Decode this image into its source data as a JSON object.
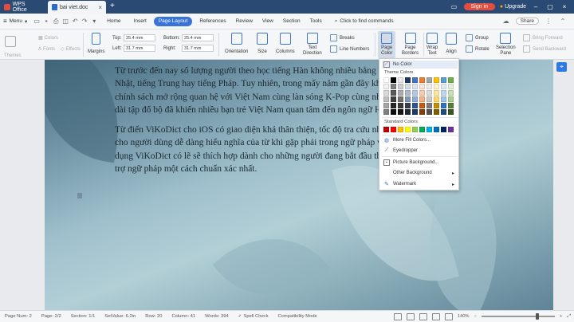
{
  "titlebar": {
    "app_tab": "WPS Office",
    "doc_tab": "bai viet.doc",
    "signin": "Sign in",
    "upgrade": "Upgrade"
  },
  "menubar": {
    "menu": "Menu",
    "tabs": [
      "Home",
      "Insert",
      "Page Layout",
      "References",
      "Review",
      "View",
      "Section",
      "Tools"
    ],
    "active_tab": "Page Layout",
    "find": "Click to find commands",
    "share": "Share"
  },
  "ribbon": {
    "themes": "Themes",
    "colors": "Colors",
    "fonts": "Fonts",
    "effects": "Effects",
    "margins": "Margins",
    "top_label": "Top:",
    "top_value": "25.4 mm",
    "bottom_label": "Bottom:",
    "bottom_value": "25.4 mm",
    "left_label": "Left:",
    "left_value": "31.7 mm",
    "right_label": "Right:",
    "right_value": "31.7 mm",
    "orientation": "Orientation",
    "size": "Size",
    "columns": "Columns",
    "text_direction_1": "Text",
    "text_direction_2": "Direction",
    "breaks": "Breaks",
    "line_numbers": "Line Numbers",
    "page_color_1": "Page",
    "page_color_2": "Color",
    "page_borders_1": "Page",
    "page_borders_2": "Borders",
    "wrap_text_1": "Wrap",
    "wrap_text_2": "Text",
    "align": "Align",
    "group": "Group",
    "rotate": "Rotate",
    "selection_pane_1": "Selection",
    "selection_pane_2": "Pane",
    "bring_forward": "Bring Forward",
    "send_backward": "Send Backward"
  },
  "document": {
    "paragraphs": [
      "Từ trước đến nay số lượng người theo học tiếng Hàn không nhiều bằng tiếng Anh, tiếng Nhật, tiếng Trung hay tiếng Pháp. Tuy nhiên, trong mấy năm gần đây khi Hàn Quốc có các chính sách mở rộng quan hệ với Việt Nam cùng làn sóng K-Pop cùng những bộ phim drama dài tập đổ bộ đã khiến nhiều bạn trẻ Việt Nam quan tâm đến ngôn ngữ Hàn Quốc.",
      "Từ điển ViKoDict cho iOS có giao diện khá thân thiện, tốc độ tra cứu nhanh chóng đã giúp cho người dùng dễ dàng hiểu nghĩa của từ khi gặp phải trong ngữ pháp và giao tiếp. Ứng dụng ViKoDict có lẽ sẽ thích hợp dành cho những người đang bắt đầu theo học tiếng Hàn, hỗ trợ ngữ pháp một cách chuẩn xác nhất."
    ]
  },
  "dropdown": {
    "no_color": "No Color",
    "theme_colors": "Theme Colors",
    "standard_colors": "Standard Colors",
    "more_fill": "More Fill Colors...",
    "eyedropper": "Eyedropper",
    "picture_background": "Picture Background...",
    "other_background": "Other Background",
    "watermark": "Watermark",
    "theme_palette": [
      [
        "#ffffff",
        "#000000",
        "#e8e8e8",
        "#1f3864",
        "#4472c4",
        "#ed7d31",
        "#a5a5a5",
        "#ffc000",
        "#5b9bd5",
        "#70ad47"
      ],
      [
        "#f2f2f2",
        "#7f7f7f",
        "#d0cece",
        "#d6dce4",
        "#dae3f3",
        "#fbe5d6",
        "#ededed",
        "#fff2cc",
        "#deebf7",
        "#e2f0d9"
      ],
      [
        "#d9d9d9",
        "#595959",
        "#aeabab",
        "#adb9ca",
        "#b4c7e7",
        "#f8cbad",
        "#dbdbdb",
        "#ffe699",
        "#bdd7ee",
        "#c5e0b4"
      ],
      [
        "#bfbfbf",
        "#404040",
        "#757171",
        "#8497b0",
        "#8faadc",
        "#f4b183",
        "#c9c9c9",
        "#ffd966",
        "#9dc3e6",
        "#a9d18e"
      ],
      [
        "#a6a6a6",
        "#262626",
        "#3a3838",
        "#333f50",
        "#2f5597",
        "#c55a11",
        "#7b7b7b",
        "#bf9000",
        "#2e75b6",
        "#548235"
      ],
      [
        "#7f7f7f",
        "#0d0d0d",
        "#171616",
        "#222a35",
        "#203864",
        "#843c0c",
        "#525252",
        "#7f6000",
        "#1f4e79",
        "#385723"
      ]
    ],
    "standard_palette": [
      "#c00000",
      "#ff0000",
      "#ffc000",
      "#ffff00",
      "#92d050",
      "#00b050",
      "#00b0f0",
      "#0070c0",
      "#002060",
      "#7030a0"
    ]
  },
  "statusbar": {
    "page_num": "Page Num: 2",
    "page": "Page: 2/2",
    "section": "Section: 1/1",
    "setvalue": "SetValue: 6.2in",
    "row": "Row: 20",
    "column": "Column: 41",
    "words": "Words: 394",
    "spell_check": "Spell Check",
    "compat": "Compatibility Mode",
    "zoom": "140%"
  }
}
